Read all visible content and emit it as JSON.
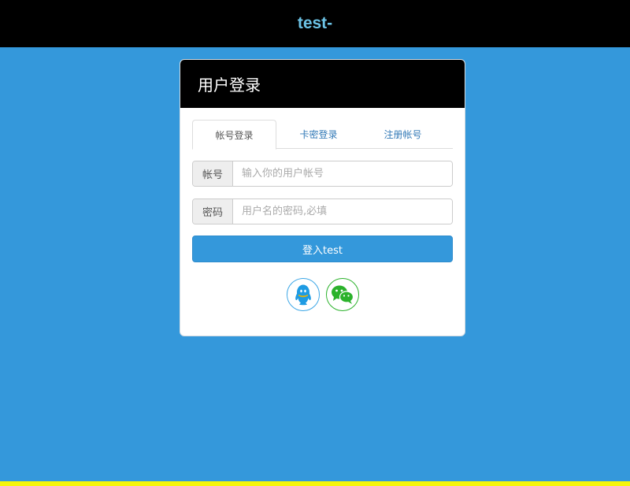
{
  "header": {
    "title": "test-"
  },
  "card": {
    "title": "用户登录",
    "tabs": [
      {
        "label": "帐号登录",
        "active": true
      },
      {
        "label": "卡密登录",
        "active": false
      },
      {
        "label": "注册帐号",
        "active": false
      }
    ],
    "account": {
      "label": "帐号",
      "placeholder": "输入你的用户帐号"
    },
    "password": {
      "label": "密码",
      "placeholder": "用户名的密码,必填"
    },
    "login_button": "登入test"
  },
  "colors": {
    "background": "#3498db",
    "header": "#000000",
    "accent_stripe": "#f5f50a",
    "qq": "#1e9be3",
    "wechat": "#2bb22b"
  },
  "icons": [
    "qq-icon",
    "wechat-icon"
  ]
}
